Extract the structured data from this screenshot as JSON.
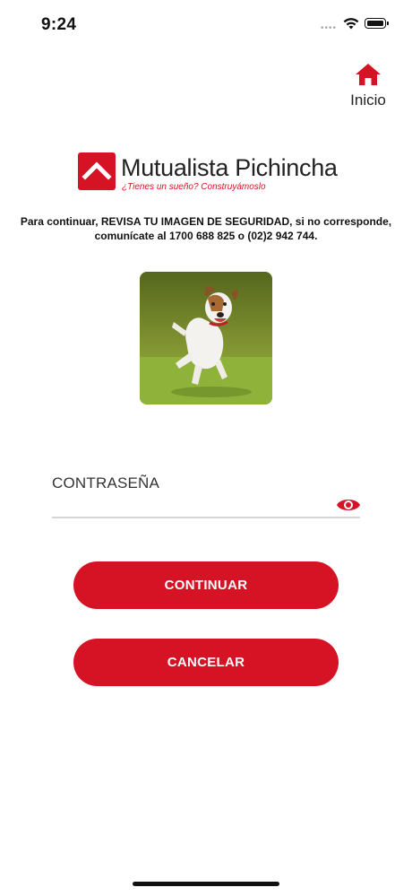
{
  "status_bar": {
    "time": "9:24",
    "signal_icon": "cellular-dots-icon",
    "wifi_icon": "wifi-icon",
    "battery_icon": "battery-icon"
  },
  "header": {
    "home_label": "Inicio",
    "home_icon": "home-icon"
  },
  "logo": {
    "name": "Mutualista Pichincha",
    "tagline": "¿Tienes un sueño? Construyámoslo"
  },
  "notice": {
    "text": "Para continuar, REVISA TU IMAGEN DE SEGURIDAD, si no corresponde, comunícate al 1700 688 825 o (02)2 942 744."
  },
  "security_image": {
    "subject": "dog-photo"
  },
  "password": {
    "label": "CONTRASEÑA",
    "value": "",
    "show_icon": "eye-icon"
  },
  "buttons": {
    "continue_label": "CONTINUAR",
    "cancel_label": "CANCELAR"
  },
  "colors": {
    "accent": "#d51325",
    "text": "#222222",
    "underline": "#d6d6d6"
  }
}
